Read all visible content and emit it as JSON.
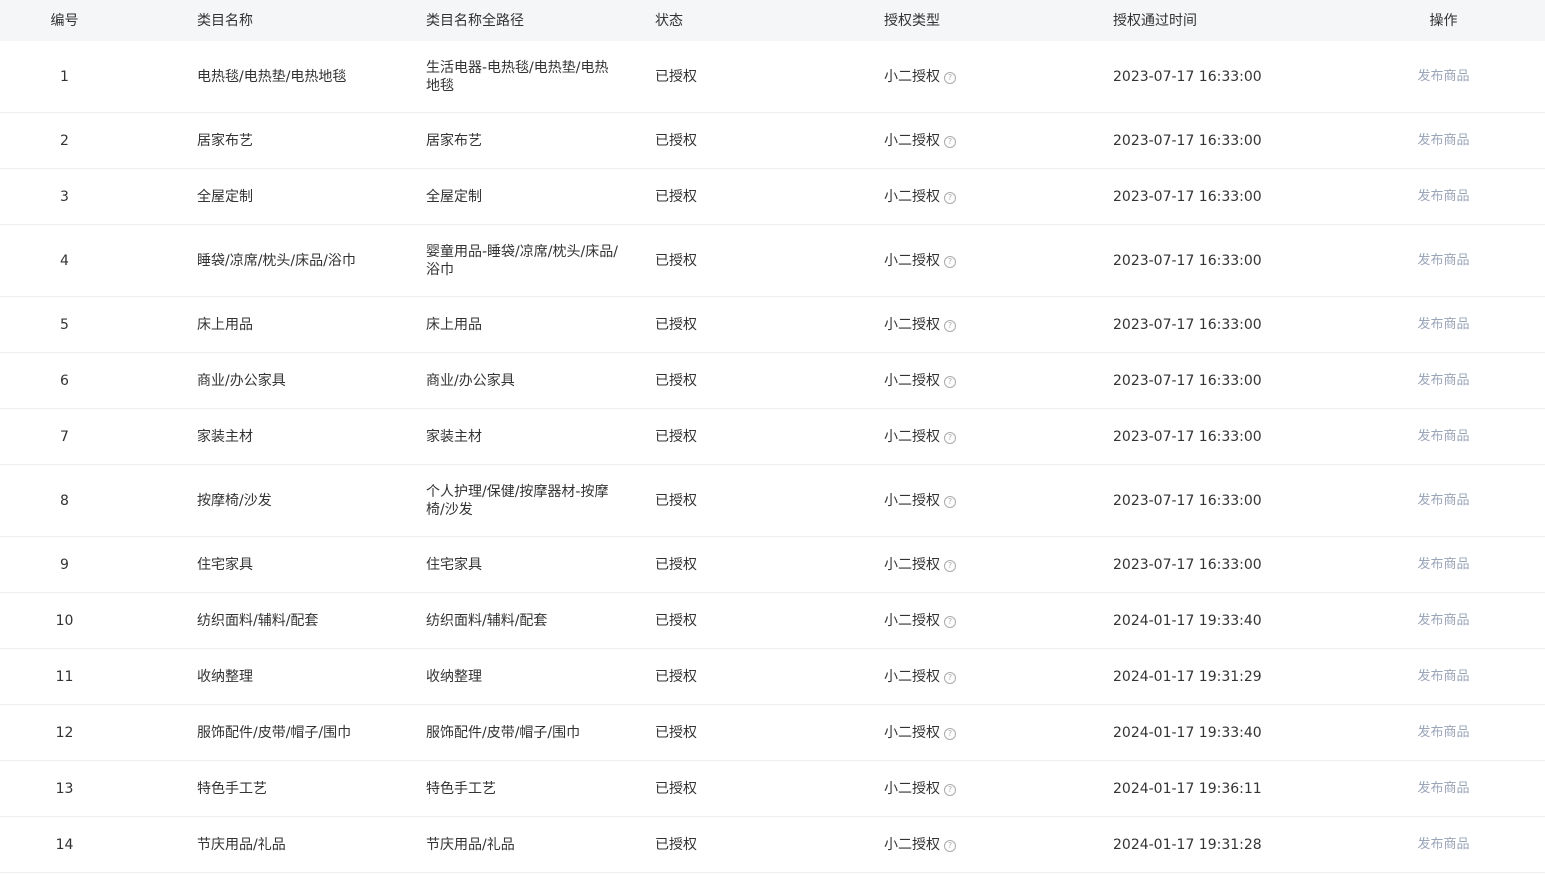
{
  "headers": {
    "id": "编号",
    "name": "类目名称",
    "path": "类目名称全路径",
    "status": "状态",
    "type": "授权类型",
    "time": "授权通过时间",
    "op": "操作"
  },
  "icons": {
    "help": "question-circle-icon"
  },
  "colors": {
    "header_bg": "#f5f6f8",
    "link": "#9aa5b8",
    "divider": "#eeeeee"
  },
  "rows": [
    {
      "id": "1",
      "name": "电热毯/电热垫/电热地毯",
      "path": "生活电器-电热毯/电热垫/电热地毯",
      "status": "已授权",
      "type": "小二授权",
      "time": "2023-07-17 16:33:00",
      "op": "发布商品"
    },
    {
      "id": "2",
      "name": "居家布艺",
      "path": "居家布艺",
      "status": "已授权",
      "type": "小二授权",
      "time": "2023-07-17 16:33:00",
      "op": "发布商品"
    },
    {
      "id": "3",
      "name": "全屋定制",
      "path": "全屋定制",
      "status": "已授权",
      "type": "小二授权",
      "time": "2023-07-17 16:33:00",
      "op": "发布商品"
    },
    {
      "id": "4",
      "name": "睡袋/凉席/枕头/床品/浴巾",
      "path": "婴童用品-睡袋/凉席/枕头/床品/浴巾",
      "status": "已授权",
      "type": "小二授权",
      "time": "2023-07-17 16:33:00",
      "op": "发布商品"
    },
    {
      "id": "5",
      "name": "床上用品",
      "path": "床上用品",
      "status": "已授权",
      "type": "小二授权",
      "time": "2023-07-17 16:33:00",
      "op": "发布商品"
    },
    {
      "id": "6",
      "name": "商业/办公家具",
      "path": "商业/办公家具",
      "status": "已授权",
      "type": "小二授权",
      "time": "2023-07-17 16:33:00",
      "op": "发布商品"
    },
    {
      "id": "7",
      "name": "家装主材",
      "path": "家装主材",
      "status": "已授权",
      "type": "小二授权",
      "time": "2023-07-17 16:33:00",
      "op": "发布商品"
    },
    {
      "id": "8",
      "name": "按摩椅/沙发",
      "path": "个人护理/保健/按摩器材-按摩椅/沙发",
      "status": "已授权",
      "type": "小二授权",
      "time": "2023-07-17 16:33:00",
      "op": "发布商品"
    },
    {
      "id": "9",
      "name": "住宅家具",
      "path": "住宅家具",
      "status": "已授权",
      "type": "小二授权",
      "time": "2023-07-17 16:33:00",
      "op": "发布商品"
    },
    {
      "id": "10",
      "name": "纺织面料/辅料/配套",
      "path": "纺织面料/辅料/配套",
      "status": "已授权",
      "type": "小二授权",
      "time": "2024-01-17 19:33:40",
      "op": "发布商品"
    },
    {
      "id": "11",
      "name": "收纳整理",
      "path": "收纳整理",
      "status": "已授权",
      "type": "小二授权",
      "time": "2024-01-17 19:31:29",
      "op": "发布商品"
    },
    {
      "id": "12",
      "name": "服饰配件/皮带/帽子/围巾",
      "path": "服饰配件/皮带/帽子/围巾",
      "status": "已授权",
      "type": "小二授权",
      "time": "2024-01-17 19:33:40",
      "op": "发布商品"
    },
    {
      "id": "13",
      "name": "特色手工艺",
      "path": "特色手工艺",
      "status": "已授权",
      "type": "小二授权",
      "time": "2024-01-17 19:36:11",
      "op": "发布商品"
    },
    {
      "id": "14",
      "name": "节庆用品/礼品",
      "path": "节庆用品/礼品",
      "status": "已授权",
      "type": "小二授权",
      "time": "2024-01-17 19:31:28",
      "op": "发布商品"
    }
  ]
}
